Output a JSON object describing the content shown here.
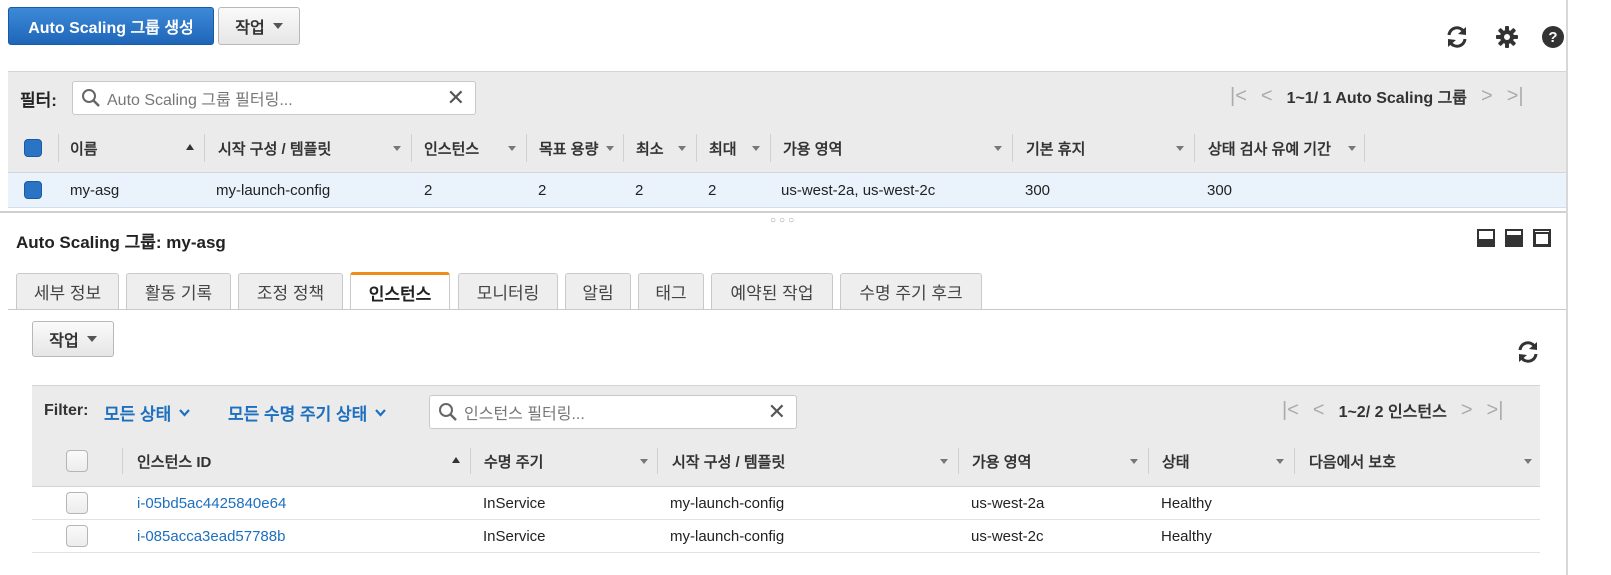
{
  "toolbar": {
    "create_label": "Auto Scaling 그룹 생성",
    "actions_label": "작업"
  },
  "filter_bar": {
    "label": "필터:",
    "placeholder": "Auto Scaling 그룹 필터링...",
    "pager_text": "1~1/ 1 Auto Scaling 그룹"
  },
  "asg_table": {
    "columns": [
      "이름",
      "시작 구성 / 템플릿",
      "인스턴스",
      "목표 용량",
      "최소",
      "최대",
      "가용 영역",
      "기본 휴지",
      "상태 검사 유예 기간"
    ],
    "rows": [
      [
        "my-asg",
        "my-launch-config",
        "2",
        "2",
        "2",
        "2",
        "us-west-2a, us-west-2c",
        "300",
        "300"
      ]
    ]
  },
  "detail": {
    "title": "Auto Scaling 그룹: my-asg",
    "tabs": [
      "세부 정보",
      "활동 기록",
      "조정 정책",
      "인스턴스",
      "모니터링",
      "알림",
      "태그",
      "예약된 작업",
      "수명 주기 후크"
    ],
    "active_tab": "인스턴스",
    "actions_label": "작업"
  },
  "instance_filter": {
    "label": "Filter:",
    "state_select": "모든 상태",
    "lifecycle_select": "모든 수명 주기 상태",
    "placeholder": "인스턴스 필터링...",
    "pager_text": "1~2/ 2 인스턴스"
  },
  "instance_table": {
    "columns": [
      "인스턴스 ID",
      "수명 주기",
      "시작 구성 / 템플릿",
      "가용 영역",
      "상태",
      "다음에서 보호"
    ],
    "rows": [
      [
        "i-05bd5ac4425840e64",
        "InService",
        "my-launch-config",
        "us-west-2a",
        "Healthy",
        ""
      ],
      [
        "i-085acca3ead57788b",
        "InService",
        "my-launch-config",
        "us-west-2c",
        "Healthy",
        ""
      ]
    ]
  },
  "colors": {
    "primary": "#2a73c5",
    "link": "#1d6fbf",
    "active_tab": "#f08c1a"
  },
  "icons": [
    "refresh-icon",
    "gear-icon",
    "help-icon",
    "search-icon",
    "clear-icon",
    "first-page-icon",
    "prev-page-icon",
    "next-page-icon",
    "last-page-icon",
    "panel-layout-icon"
  ]
}
